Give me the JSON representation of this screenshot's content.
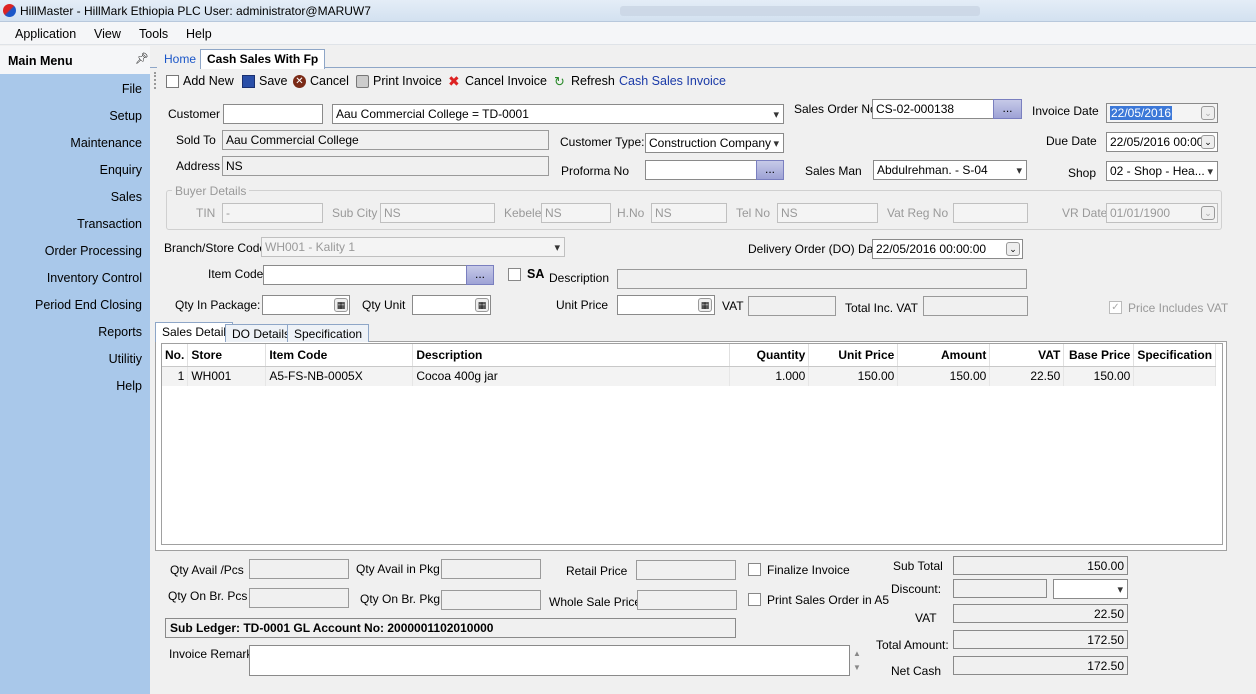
{
  "window": {
    "title": "HillMaster - HillMark Ethiopia PLC     User: administrator@MARUW7"
  },
  "menu": [
    "Application",
    "View",
    "Tools",
    "Help"
  ],
  "sidebar": {
    "title": "Main Menu",
    "items": [
      "File",
      "Setup",
      "Maintenance",
      "Enquiry",
      "Sales",
      "Transaction",
      "Order Processing",
      "Inventory Control",
      "Period End Closing",
      "Reports",
      "Utilitiy",
      "Help"
    ]
  },
  "tabs": [
    "Home",
    "Cash Sales With Fp"
  ],
  "toolbar": {
    "add": "Add New",
    "save": "Save",
    "cancel": "Cancel",
    "print": "Print Invoice",
    "cancel_invoice": "Cancel Invoice",
    "refresh": "Refresh",
    "heading": "Cash Sales Invoice"
  },
  "header": {
    "customer_label": "Customer",
    "customer_code": "",
    "customer_name": "Aau Commercial College = TD-0001",
    "sold_to_label": "Sold To",
    "sold_to": "Aau Commercial College",
    "address_label": "Address",
    "address": "NS",
    "customer_type_label": "Customer Type:",
    "customer_type": "Construction Company",
    "proforma_label": "Proforma No",
    "proforma": "",
    "sales_order_label": "Sales Order No.",
    "sales_order": "CS-02-000138",
    "sales_man_label": "Sales Man",
    "sales_man": "Abdulrehman. - S-04",
    "invoice_date_label": "Invoice Date",
    "invoice_date": "22/05/2016",
    "due_date_label": "Due Date",
    "due_date": "22/05/2016 00:00",
    "shop_label": "Shop",
    "shop": "02 - Shop - Hea...",
    "dots": "..."
  },
  "buyer": {
    "legend": "Buyer Details",
    "tin_label": "TIN",
    "tin": "-",
    "subcity_label": "Sub City",
    "subcity": "NS",
    "kebele_label": "Kebele",
    "kebele": "NS",
    "hno_label": "H.No",
    "hno": "NS",
    "tel_label": "Tel No",
    "tel": "NS",
    "vatreg_label": "Vat Reg No",
    "vatreg": "",
    "vrdate_label": "VR Date",
    "vrdate": "01/01/1900"
  },
  "item": {
    "branch_label": "Branch/Store Code:",
    "branch": "WH001 - Kality 1",
    "do_date_label": "Delivery Order (DO) Date",
    "do_date": "22/05/2016 00:00:00",
    "item_code_label": "Item Code:",
    "sa_label": "SA",
    "description_label": "Description",
    "qty_pkg_label": "Qty In Package:",
    "qty_unit_label": "Qty Unit",
    "unit_price_label": "Unit Price",
    "vat_label": "VAT",
    "total_inc_label": "Total Inc. VAT",
    "price_inc_vat_label": "Price Includes VAT"
  },
  "detail_tabs": [
    "Sales Detail",
    "DO Details",
    "Specification"
  ],
  "grid": {
    "columns": [
      "No.",
      "Store",
      "Item Code",
      "Description",
      "Quantity",
      "Unit Price",
      "Amount",
      "VAT",
      "Base Price",
      "Specification"
    ],
    "rows": [
      [
        "1",
        "WH001",
        "A5-FS-NB-0005X",
        "Cocoa 400g jar",
        "1.000",
        "150.00",
        "150.00",
        "22.50",
        "150.00",
        ""
      ]
    ]
  },
  "footer": {
    "qty_avail_pcs": "Qty Avail /Pcs",
    "qty_avail_pkg": "Qty Avail in Pkg",
    "retail_price": "Retail Price",
    "qty_br_pcs": "Qty On Br. Pcs",
    "qty_br_pkg": "Qty On Br. Pkg",
    "whole_sale": "Whole Sale Price",
    "finalize": "Finalize Invoice",
    "print_so": "Print Sales Order in A5",
    "ledger": "Sub Ledger: TD-0001  GL Account No: 2000001102010000",
    "remark_label": "Invoice Remark:"
  },
  "totals": {
    "sub_total_label": "Sub Total",
    "sub_total": "150.00",
    "discount_label": "Discount:",
    "vat_label": "VAT",
    "vat": "22.50",
    "total_label": "Total Amount:",
    "total": "172.50",
    "net_label": "Net Cash",
    "net": "172.50"
  }
}
